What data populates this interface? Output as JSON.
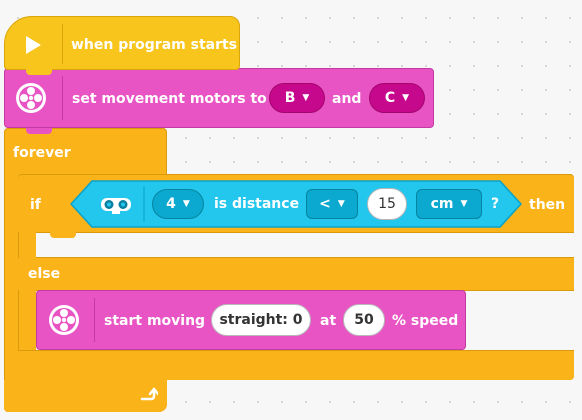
{
  "start_block": {
    "label": "when program starts",
    "icon": "play-icon",
    "color": "#f7c51c"
  },
  "set_motors_block": {
    "label": "set movement motors to",
    "port_left": "B",
    "connector": "and",
    "port_right": "C",
    "icon": "motor-pair-icon",
    "color": "#e854c4"
  },
  "forever_block": {
    "label": "forever",
    "loop_icon": "loop-arrow-icon",
    "color": "#fbb31a"
  },
  "if_block": {
    "if_label": "if",
    "then_label": "then",
    "else_label": "else",
    "condition": {
      "sensor_icon": "distance-sensor-icon",
      "port": "4",
      "text": "is distance",
      "comparator": "<",
      "value": "15",
      "unit": "cm",
      "question": "?",
      "color": "#23c6ec"
    }
  },
  "start_moving_block": {
    "label": "start moving",
    "direction": "straight: 0",
    "at_label": "at",
    "speed": "50",
    "speed_unit": "% speed",
    "icon": "motor-pair-icon",
    "color": "#e854c4"
  }
}
